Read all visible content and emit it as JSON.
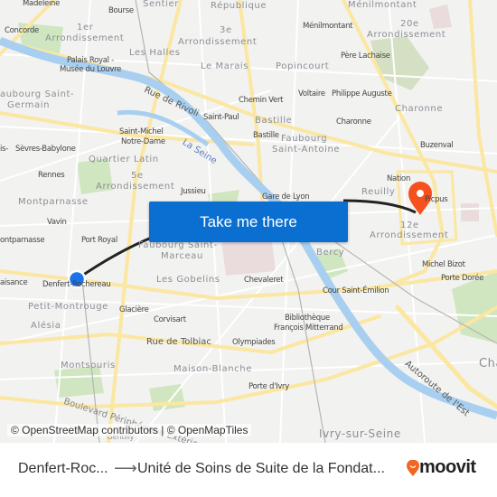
{
  "map": {
    "labels": [
      "Madeleine",
      "Bourse",
      "Sentier",
      "République",
      "Ménilmontant",
      "Concorde",
      "1er",
      "Arrondissement",
      "3e",
      "Arrondissement",
      "Ménilmontant",
      "20e",
      "Arrondissement",
      "Les Halles",
      "Palais Royal -",
      "Musée du Louvre",
      "Le Marais",
      "Popincourt",
      "Père Lachaise",
      "Rue de Rivoli",
      "aubourg Saint-",
      "Germain",
      "Chemin Vert",
      "Voltaire",
      "Philippe Auguste",
      "Charonne",
      "Saint-Paul",
      "Bastille",
      "Charonne",
      "Saint-Michel",
      "Notre-Dame",
      "Bastille",
      "Faubourg",
      "Saint-Antoine",
      "La Seine",
      "is-",
      "Sèvres-Babylone",
      "Buzenval",
      "Quartier Latin",
      "Rennes",
      "5e",
      "Arrondissement",
      "Jussieu",
      "Nation",
      "Montparnasse",
      "Gare de Lyon",
      "Reuilly",
      "Picpus",
      "Vavin",
      "12e",
      "Arrondissement",
      "Port Royal",
      "Faubourg Saint-",
      "Marceau",
      "ontparnasse",
      "Bercy",
      "Michel Bizot",
      "aisance",
      "Denfert-Rochereau",
      "Les Gobelins",
      "Chevaleret",
      "Porte Dorée",
      "Petit-Montrouge",
      "Glacière",
      "Cour Saint-Émilion",
      "Alésia",
      "Corvisart",
      "Bibliothèque",
      "François Mitterrand",
      "Rue de Tolbiac",
      "Olympiades",
      "Montsouris",
      "Maison-Blanche",
      "Cha",
      "Porte d'Ivry",
      "Autoroute de l'Est",
      "Boulevard Périphérique Extérieur",
      "Gentilly",
      "Ivry-sur-Seine"
    ],
    "origin_marker_color": "#1a73e8",
    "destination_marker_color": "#f4511e",
    "route_color": "#222222",
    "destination_icon": "map-pin-icon"
  },
  "cta": {
    "label": "Take me there",
    "color": "#0a6fd1"
  },
  "attribution": "© OpenStreetMap contributors | © OpenMapTiles",
  "footer": {
    "from": "Denfert-Roc...",
    "arrow_icon": "arrow-right-icon",
    "to": "Unité de Soins de Suite de la Fondat...",
    "brand": "moovit",
    "brand_color": "#f26522"
  }
}
